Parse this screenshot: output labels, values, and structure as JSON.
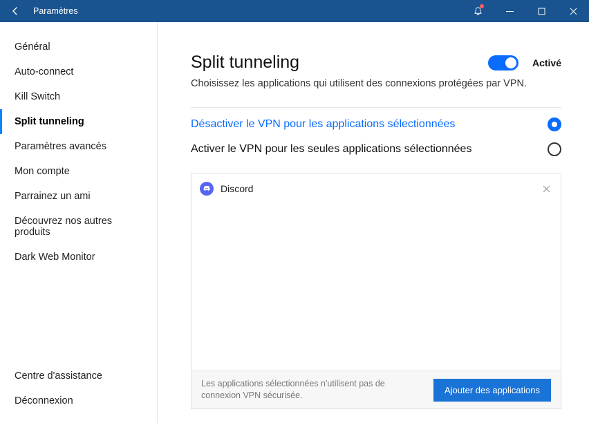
{
  "window": {
    "title": "Paramètres"
  },
  "sidebar": {
    "items": [
      {
        "label": "Général"
      },
      {
        "label": "Auto-connect"
      },
      {
        "label": "Kill Switch"
      },
      {
        "label": "Split tunneling",
        "active": true
      },
      {
        "label": "Paramètres avancés"
      },
      {
        "label": "Mon compte"
      },
      {
        "label": "Parrainez un ami"
      },
      {
        "label": "Découvrez nos autres produits"
      },
      {
        "label": "Dark Web Monitor"
      }
    ],
    "bottom": [
      {
        "label": "Centre d'assistance"
      },
      {
        "label": "Déconnexion"
      }
    ]
  },
  "main": {
    "title": "Split tunneling",
    "subtitle": "Choisissez les applications qui utilisent des connexions protégées par VPN.",
    "toggle_label": "Activé",
    "options": [
      {
        "label": "Désactiver le VPN pour les applications sélectionnées",
        "selected": true
      },
      {
        "label": "Activer le VPN pour les seules applications sélectionnées",
        "selected": false
      }
    ],
    "apps": [
      {
        "name": "Discord",
        "icon": "discord-icon"
      }
    ],
    "footer_note": "Les applications sélectionnées n'utilisent pas de connexion VPN sécurisée.",
    "add_button": "Ajouter des applications"
  }
}
